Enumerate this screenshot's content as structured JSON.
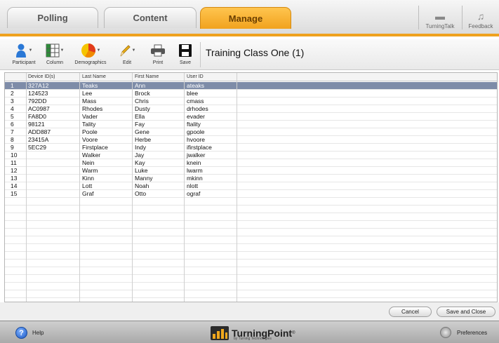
{
  "tabs": [
    {
      "label": "Polling",
      "active": false
    },
    {
      "label": "Content",
      "active": false
    },
    {
      "label": "Manage",
      "active": true
    }
  ],
  "utilities": {
    "turningtalk_label": "TurningTalk",
    "feedback_label": "Feedback"
  },
  "toolbar": {
    "participant_label": "Participant",
    "column_label": "Column",
    "demographics_label": "Demographics",
    "edit_label": "Edit",
    "print_label": "Print",
    "save_label": "Save"
  },
  "class_title": "Training Class One (1)",
  "table": {
    "columns": [
      "Device ID(s)",
      "Last Name",
      "First Name",
      "User ID"
    ],
    "rows": [
      {
        "num": "1",
        "device": "327A12",
        "last": "Teaks",
        "first": "Ann",
        "user": "ateaks"
      },
      {
        "num": "2",
        "device": "124523",
        "last": "Lee",
        "first": "Brock",
        "user": "blee"
      },
      {
        "num": "3",
        "device": "792DD",
        "last": "Mass",
        "first": "Chris",
        "user": "cmass"
      },
      {
        "num": "4",
        "device": "AC0987",
        "last": "Rhodes",
        "first": "Dusty",
        "user": "drhodes"
      },
      {
        "num": "5",
        "device": "FA8D0",
        "last": "Vader",
        "first": "Ella",
        "user": "evader"
      },
      {
        "num": "6",
        "device": "98121",
        "last": "Tality",
        "first": "Fay",
        "user": "ftality"
      },
      {
        "num": "7",
        "device": "ADD887",
        "last": "Poole",
        "first": "Gene",
        "user": "gpoole"
      },
      {
        "num": "8",
        "device": "23415A",
        "last": "Voore",
        "first": "Herbe",
        "user": "hvoore"
      },
      {
        "num": "9",
        "device": "5EC29",
        "last": "Firstplace",
        "first": "Indy",
        "user": "ifirstplace"
      },
      {
        "num": "10",
        "device": "",
        "last": "Walker",
        "first": "Jay",
        "user": "jwalker"
      },
      {
        "num": "11",
        "device": "",
        "last": "Nein",
        "first": "Kay",
        "user": "knein"
      },
      {
        "num": "12",
        "device": "",
        "last": "Warm",
        "first": "Luke",
        "user": "lwarm"
      },
      {
        "num": "13",
        "device": "",
        "last": "Kinn",
        "first": "Manny",
        "user": "mkinn"
      },
      {
        "num": "14",
        "device": "",
        "last": "Lott",
        "first": "Noah",
        "user": "nlott"
      },
      {
        "num": "15",
        "device": "",
        "last": "Graf",
        "first": "Otto",
        "user": "ograf"
      }
    ],
    "selected_row": 1
  },
  "buttons": {
    "cancel_label": "Cancel",
    "save_close_label": "Save and Close"
  },
  "statusbar": {
    "help_label": "Help",
    "brand_name": "TurningPoint",
    "brand_tm": "®",
    "brand_sub": "by Turning Technologies",
    "preferences_label": "Preferences"
  },
  "colors": {
    "accent": "#efa21f",
    "selection": "#7e8ca8"
  }
}
